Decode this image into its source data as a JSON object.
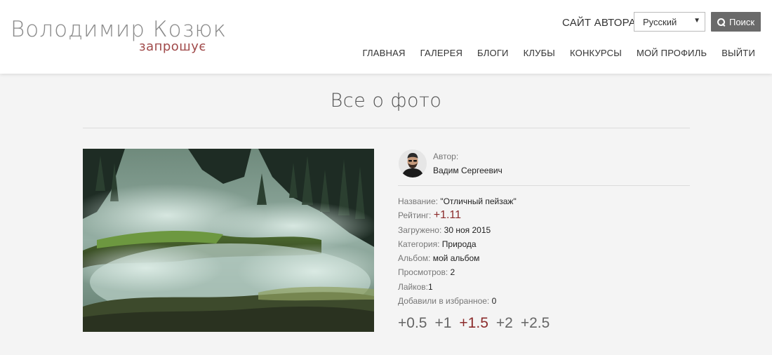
{
  "logo": {
    "name": "Володимир Козюк",
    "tagline": "запрошує"
  },
  "header": {
    "author_site": "САЙТ АВТОРА",
    "language": {
      "selected": "Русский"
    },
    "search_label": "Поиск"
  },
  "nav": [
    "ГЛАВНАЯ",
    "ГАЛЕРЕЯ",
    "БЛОГИ",
    "КЛУБЫ",
    "КОНКУРСЫ",
    "МОЙ ПРОФИЛЬ",
    "ВЫЙТИ"
  ],
  "page": {
    "title": "Все о фото"
  },
  "author": {
    "label": "Автор:",
    "name": "Вадим Сергеевич"
  },
  "photo_info": {
    "title_label": "Название:",
    "title_value": "\"Отличный пейзаж\"",
    "rating_label": "Рейтинг:",
    "rating_value": "+1.11",
    "uploaded_label": "Загружено:",
    "uploaded_value": "30 ноя 2015",
    "category_label": "Категория:",
    "category_value": "Природа",
    "album_label": "Альбом:",
    "album_value": "мой альбом",
    "views_label": "Просмотров:",
    "views_value": "2",
    "likes_label": "Лайков:",
    "likes_value": "1",
    "favorites_label": "Добавили в избранное:",
    "favorites_value": "0"
  },
  "votes": [
    "+0.5",
    "+1",
    "+1.5",
    "+2",
    "+2.5"
  ],
  "colors": {
    "accent": "#8b2b2b",
    "logo_sub": "#a04a4a",
    "search_button": "#6a6a6a"
  }
}
